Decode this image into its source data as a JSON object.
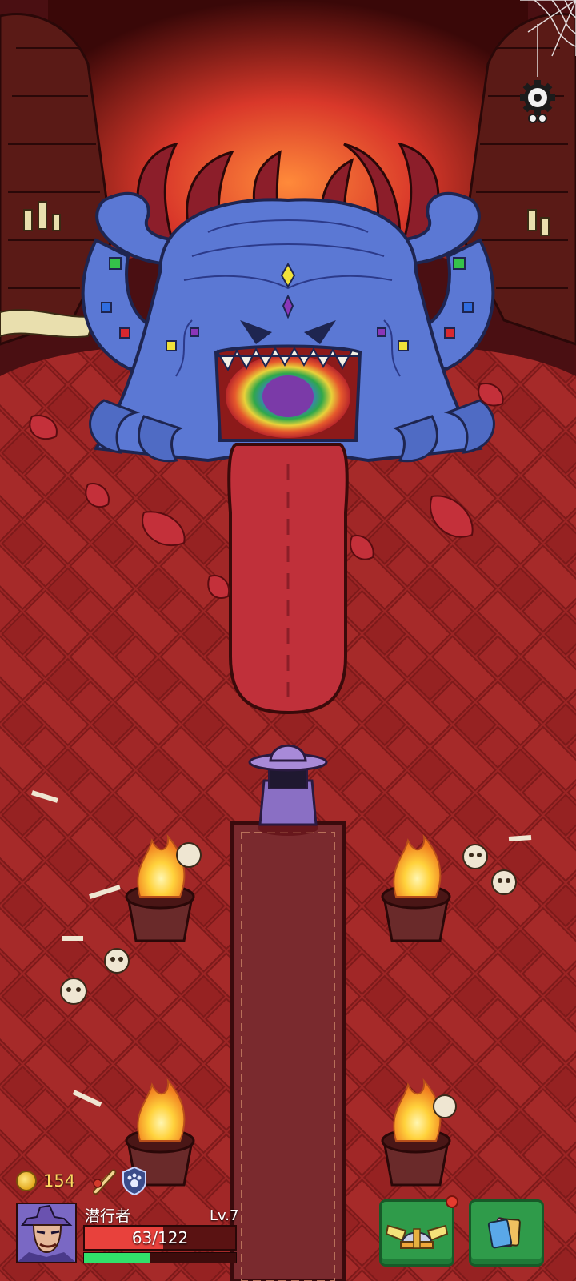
{
  "currency": {
    "coins": "154"
  },
  "player": {
    "name": "潜行者",
    "level": "Lv.7",
    "hp_text": "63/122",
    "hp_fraction": 0.52,
    "xp_fraction": 0.43
  },
  "icons": {
    "settings": "gear-icon",
    "coin": "coin-icon",
    "quest_scroll": "scroll-icon",
    "badge": "paw-badge-icon",
    "hero_menu": "winged-helmet-icon",
    "card_menu": "cards-icon"
  },
  "colors": {
    "floor": "#9a2323",
    "boss_blue": "#5b78d4",
    "tongue": "#c0303a",
    "button_green": "#2f9b4a",
    "hp_red": "#e8413c",
    "xp_green": "#31e06a",
    "coin_gold": "#ffd960"
  }
}
